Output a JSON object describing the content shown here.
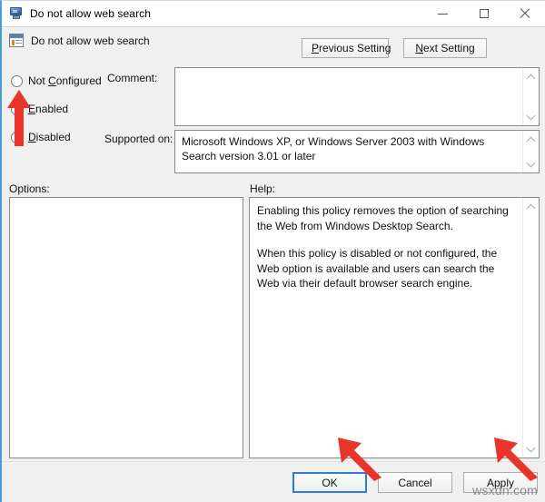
{
  "window": {
    "title": "Do not allow web search",
    "title_icon": "monitor-icon",
    "controls": {
      "minimize": "minimize-icon",
      "maximize": "maximize-icon",
      "close": "close-icon"
    }
  },
  "header": {
    "policy_icon": "policy-setting-icon",
    "policy_name": "Do not allow web search",
    "previous_setting": "Previous Setting",
    "previous_setting_accel": "P",
    "next_setting": "Next Setting",
    "next_setting_accel": "N"
  },
  "state_options": [
    {
      "label": "Not Configured",
      "accel": "C",
      "selected": false
    },
    {
      "label": "Enabled",
      "accel": "E",
      "selected": true
    },
    {
      "label": "Disabled",
      "accel": "D",
      "selected": false
    }
  ],
  "comment": {
    "label": "Comment:",
    "value": "",
    "placeholder": ""
  },
  "supported_on": {
    "label": "Supported on:",
    "value": "Microsoft Windows XP, or Windows Server 2003 with Windows Search version 3.01 or later"
  },
  "options": {
    "label": "Options:",
    "value": ""
  },
  "help": {
    "label": "Help:",
    "paragraphs": [
      "Enabling this policy removes the option of searching the Web from Windows Desktop Search.",
      "When this policy is disabled or not configured, the Web option is available and users can search the Web via their default browser search engine."
    ]
  },
  "footer": {
    "ok": "OK",
    "cancel": "Cancel",
    "apply": "Apply"
  },
  "annotations": {
    "arrow_color": "#e8342a",
    "arrow_enabled_radio": "arrow-pointing-to-enabled-radio",
    "arrow_ok": "arrow-pointing-to-ok-button",
    "arrow_apply": "arrow-pointing-to-apply-button"
  },
  "watermark": "wsxdn.com"
}
